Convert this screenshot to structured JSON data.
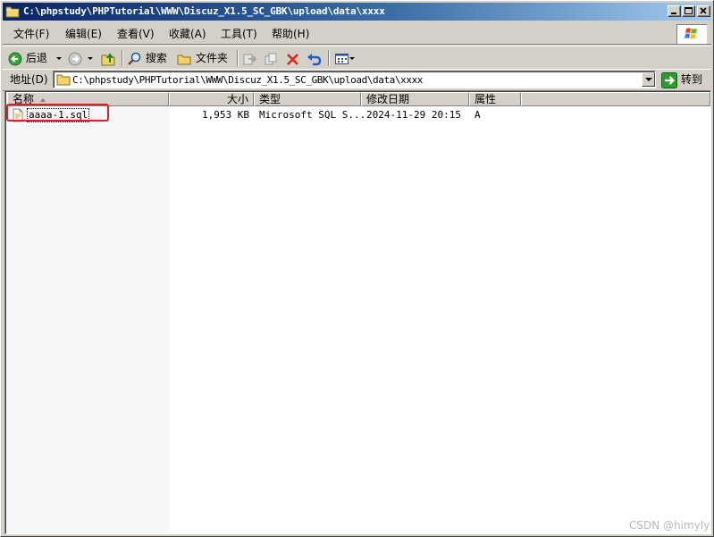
{
  "window": {
    "title": "C:\\phpstudy\\PHPTutorial\\WWW\\Discuz_X1.5_SC_GBK\\upload\\data\\xxxx",
    "caption_buttons": [
      "minimize",
      "maximize",
      "close"
    ]
  },
  "menu": {
    "items": [
      {
        "label": "文件(F)"
      },
      {
        "label": "编辑(E)"
      },
      {
        "label": "查看(V)"
      },
      {
        "label": "收藏(A)"
      },
      {
        "label": "工具(T)"
      },
      {
        "label": "帮助(H)"
      }
    ]
  },
  "toolbar": {
    "back_label": "后退",
    "search_label": "搜索",
    "folders_label": "文件夹",
    "icons": [
      "back-icon",
      "forward-icon",
      "up-folder-icon",
      "search-icon",
      "folders-icon",
      "move-to-icon",
      "copy-to-icon",
      "delete-icon",
      "undo-icon",
      "views-icon"
    ]
  },
  "address": {
    "label": "地址(D)",
    "value": "C:\\phpstudy\\PHPTutorial\\WWW\\Discuz_X1.5_SC_GBK\\upload\\data\\xxxx",
    "go_label": "转到"
  },
  "list": {
    "columns": {
      "name": "名称",
      "size": "大小",
      "type": "类型",
      "modified": "修改日期",
      "attributes": "属性"
    },
    "rows": [
      {
        "name": "aaaa-1.sql",
        "size": "1,953 KB",
        "type": "Microsoft SQL S...",
        "modified": "2024-11-29 20:15",
        "attributes": "A"
      }
    ]
  },
  "watermark": "CSDN @himyly",
  "colors": {
    "titlebar_start": "#0a246a",
    "titlebar_end": "#a6caf0",
    "face": "#d4d0c8",
    "highlight_box": "#e02020"
  }
}
